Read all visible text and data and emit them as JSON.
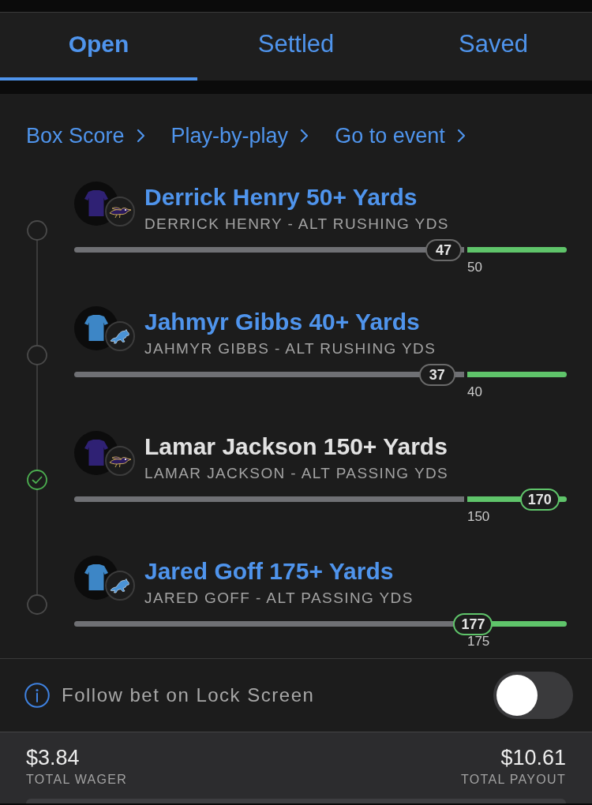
{
  "tabs": [
    {
      "label": "Open",
      "selected": true
    },
    {
      "label": "Settled",
      "selected": false
    },
    {
      "label": "Saved",
      "selected": false
    }
  ],
  "links": [
    {
      "label": "Box Score"
    },
    {
      "label": "Play-by-play"
    },
    {
      "label": "Go to event"
    }
  ],
  "legs": [
    {
      "title": "Derrick Henry 50+ Yards",
      "subtitle": "DERRICK HENRY - ALT RUSHING YDS",
      "settled": false,
      "avatar": {
        "kind": "bird",
        "color": "#2f2174"
      },
      "progress": {
        "current": "47",
        "target": "50",
        "level": 0.75,
        "line_reached": false
      }
    },
    {
      "title": "Jahmyr Gibbs 40+ Yards",
      "subtitle": "JAHMYR GIBBS - ALT RUSHING YDS",
      "settled": false,
      "avatar": {
        "kind": "lion",
        "color": "#3d86c6"
      },
      "progress": {
        "current": "37",
        "target": "40",
        "level": 0.737,
        "line_reached": false
      }
    },
    {
      "title": "Lamar Jackson 150+ Yards",
      "subtitle": "LAMAR JACKSON - ALT PASSING YDS",
      "settled": true,
      "avatar": {
        "kind": "bird",
        "color": "#2f2174"
      },
      "progress": {
        "current": "170",
        "target": "150",
        "level": 0.945,
        "line_reached": true
      }
    },
    {
      "title": "Jared Goff 175+ Yards",
      "subtitle": "JARED GOFF - ALT PASSING YDS",
      "settled": false,
      "avatar": {
        "kind": "lion",
        "color": "#3d86c6"
      },
      "progress": {
        "current": "177",
        "target": "175",
        "level": 0.81,
        "line_reached": true
      }
    }
  ],
  "lock_screen": {
    "label": "Follow bet on Lock Screen",
    "on": false
  },
  "totals": [
    {
      "amount": "$3.84",
      "label": "TOTAL WAGER"
    },
    {
      "amount": "$10.61",
      "label": "TOTAL PAYOUT"
    }
  ]
}
